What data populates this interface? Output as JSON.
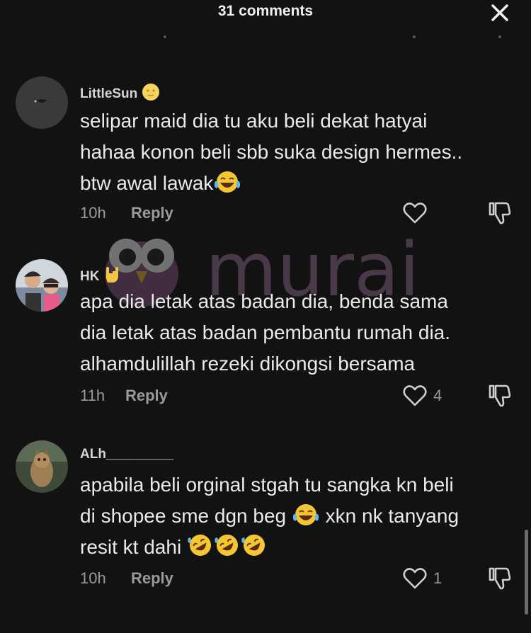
{
  "header": {
    "title": "31 comments",
    "close_icon": "close-icon"
  },
  "watermark": {
    "text": "murai",
    "mascot_icon": "owl-icon"
  },
  "comments": [
    {
      "username": "LittleSun",
      "username_emoji": "sun-face-emoji",
      "lines": [
        "selipar maid dia tu aku beli dekat hatyai",
        "hahaa konon beli sbb suka design hermes..",
        "btw awal lawak"
      ],
      "time": "10h",
      "reply_label": "Reply",
      "like_count": ""
    },
    {
      "username": "HK",
      "username_emoji": "rock-hand-emoji",
      "lines": [
        "apa dia letak atas badan dia, benda sama",
        "dia letak atas badan pembantu rumah dia.",
        "alhamdulillah rezeki dikongsi bersama"
      ],
      "time": "11h",
      "reply_label": "Reply",
      "like_count": "4"
    },
    {
      "username": "ALh_________",
      "lines": [
        "apabila beli orginal stgah tu sangka kn beli",
        "di shopee sme dgn beg",
        "xkn nk tanyang",
        "resit kt dahi"
      ],
      "time": "10h",
      "reply_label": "Reply",
      "like_count": "1"
    }
  ],
  "colors": {
    "background": "#121212",
    "text": "#eaeaea",
    "muted": "#9a9a9a",
    "emoji_yellow": "#f6c532"
  }
}
